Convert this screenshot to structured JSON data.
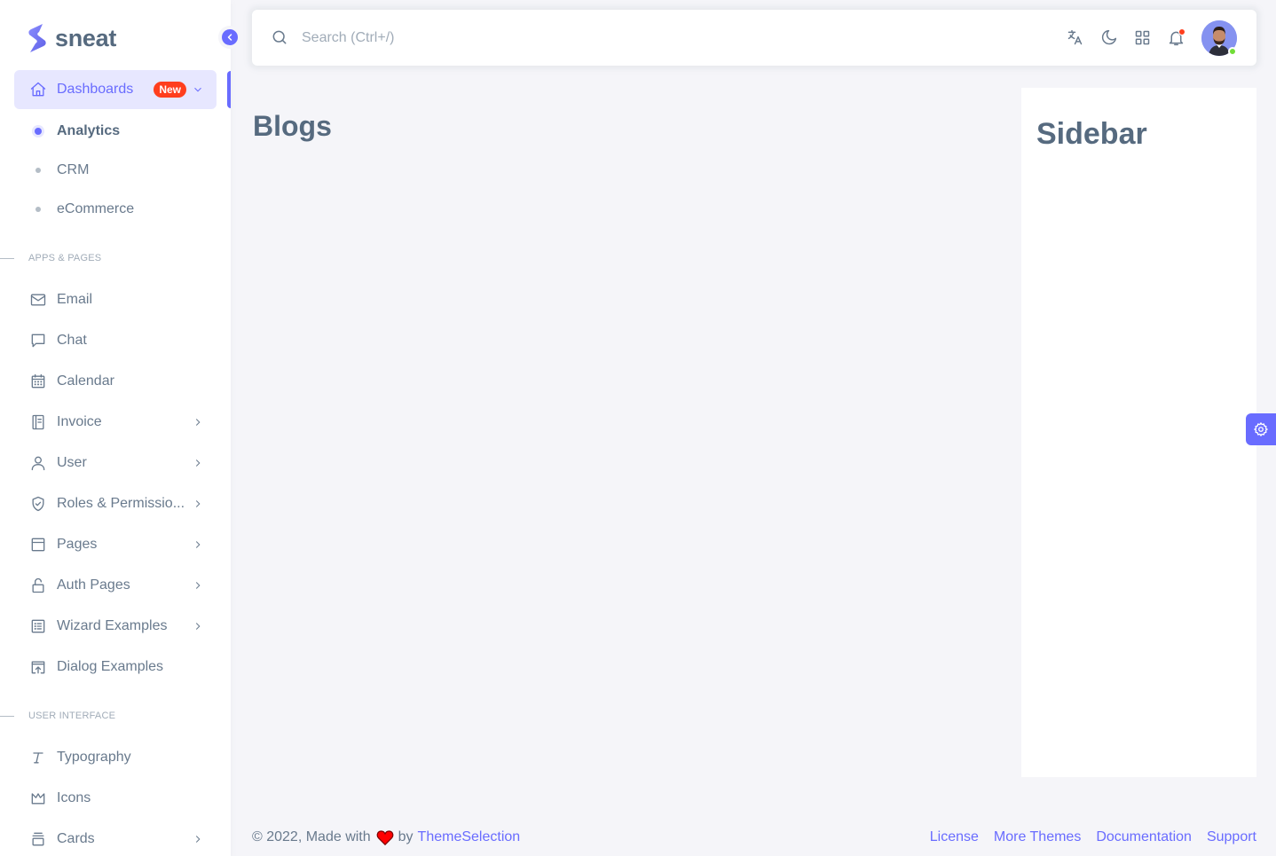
{
  "brand": {
    "name": "sneat"
  },
  "sidebar": {
    "dashboards": {
      "label": "Dashboards",
      "badge": "New"
    },
    "dashboard_sub": [
      "Analytics",
      "CRM",
      "eCommerce"
    ],
    "header_apps": "APPS & PAGES",
    "apps": [
      {
        "label": "Email",
        "icon": "mail-icon",
        "has_submenu": false
      },
      {
        "label": "Chat",
        "icon": "chat-icon",
        "has_submenu": false
      },
      {
        "label": "Calendar",
        "icon": "calendar-icon",
        "has_submenu": false
      },
      {
        "label": "Invoice",
        "icon": "invoice-icon",
        "has_submenu": true
      },
      {
        "label": "User",
        "icon": "user-icon",
        "has_submenu": true
      },
      {
        "label": "Roles & Permissio...",
        "icon": "shield-icon",
        "has_submenu": true
      },
      {
        "label": "Pages",
        "icon": "pages-icon",
        "has_submenu": true
      },
      {
        "label": "Auth Pages",
        "icon": "lock-icon",
        "has_submenu": true
      },
      {
        "label": "Wizard Examples",
        "icon": "wizard-icon",
        "has_submenu": true
      },
      {
        "label": "Dialog Examples",
        "icon": "dialog-icon",
        "has_submenu": false
      }
    ],
    "header_ui": "USER INTERFACE",
    "ui": [
      {
        "label": "Typography",
        "icon": "typography-icon",
        "has_submenu": false
      },
      {
        "label": "Icons",
        "icon": "crown-icon",
        "has_submenu": false
      },
      {
        "label": "Cards",
        "icon": "cards-icon",
        "has_submenu": true
      }
    ]
  },
  "navbar": {
    "search_placeholder": "Search (Ctrl+/)",
    "icons": [
      "translate-icon",
      "moon-icon",
      "grid-icon",
      "bell-icon"
    ]
  },
  "main": {
    "title": "Blogs"
  },
  "right_sidebar": {
    "title": "Sidebar"
  },
  "footer": {
    "copyright_prefix": "© 2022, Made with",
    "by": "by",
    "author": "ThemeSelection",
    "links": [
      "License",
      "More Themes",
      "Documentation",
      "Support"
    ]
  },
  "colors": {
    "primary": "#696cff",
    "danger": "#ff3e1d",
    "success": "#71dd37",
    "text": "#697a8d",
    "heading": "#566a7f",
    "background": "#f5f5f9"
  }
}
